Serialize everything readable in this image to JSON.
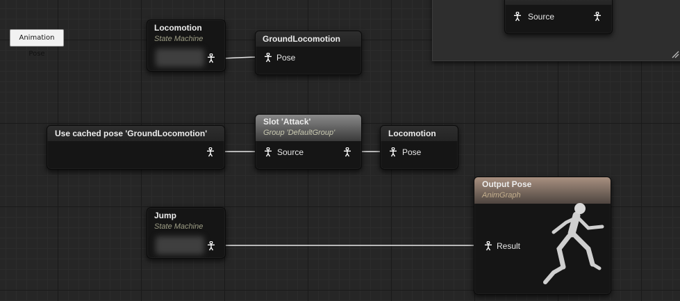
{
  "tooltip": {
    "text": "Animation Pose"
  },
  "nodes": {
    "locomotion_sm": {
      "title": "Locomotion",
      "subtitle": "State Machine"
    },
    "ground_locomotion": {
      "title": "GroundLocomotion",
      "pin": "Pose"
    },
    "cached_pose": {
      "title": "Use cached pose 'GroundLocomotion'"
    },
    "slot_attack": {
      "title": "Slot 'Attack'",
      "subtitle": "Group 'DefaultGroup'",
      "pin": "Source"
    },
    "locomotion_cache": {
      "title": "Locomotion",
      "pin": "Pose"
    },
    "jump_sm": {
      "title": "Jump",
      "subtitle": "State Machine"
    },
    "output_pose": {
      "title": "Output Pose",
      "subtitle": "AnimGraph",
      "pin": "Result"
    },
    "top_partial": {
      "pin": "Source"
    }
  },
  "icons": {
    "pose_pin": "person-pose-icon",
    "preview": "mannequin-running-icon"
  },
  "colors": {
    "wire": "#ffffff",
    "pin": "#ffffff",
    "output_header": "#a89080"
  }
}
